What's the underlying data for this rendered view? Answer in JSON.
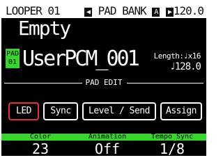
{
  "status": {
    "looper": "LOOPER 01",
    "pad_bank_label": "PAD BANK",
    "pad_bank_value": "A",
    "tempo_symbol": "♩",
    "tempo": "120.0"
  },
  "header": {
    "title": "Empty"
  },
  "pad": {
    "badge_top": "PAD",
    "badge_bottom": "01",
    "name": "UserPCM_001",
    "length_label": "Length:",
    "length_value": "♩x16",
    "bpm_symbol": "♩",
    "bpm": "128.0"
  },
  "section": {
    "label": "PAD EDIT"
  },
  "tabs": [
    {
      "label": "LED"
    },
    {
      "label": "Sync"
    },
    {
      "label": "Level / Send"
    },
    {
      "label": "Assign"
    }
  ],
  "params": [
    {
      "label": "Color",
      "value": "23"
    },
    {
      "label": "Animation",
      "value": "Off"
    },
    {
      "label": "Tempo Sync",
      "value": "1/8"
    }
  ],
  "colors": {
    "accent_green": "#36d62b",
    "active_tab_red": "#e8332a"
  },
  "icons": {
    "bank_left": "triangle-left-icon",
    "bank_right": "triangle-right-icon",
    "tempo": "quarter-note-icon"
  }
}
